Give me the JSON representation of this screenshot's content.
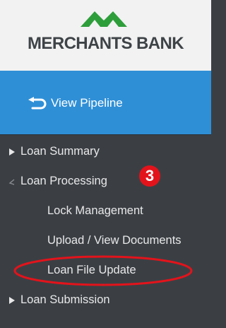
{
  "header": {
    "logo_text": "MERCHANTS BANK",
    "logo_colors": {
      "mark": "#2e9e3b",
      "text": "#3e4347"
    }
  },
  "top_bar": {
    "view_pipeline_label": "View Pipeline",
    "icon": "return-arrow-icon",
    "background": "#2f8fd6"
  },
  "sidebar": {
    "background": "#3b3f44",
    "items": [
      {
        "label": "Loan Summary",
        "state": "collapsed",
        "icon": "caret-right-icon"
      },
      {
        "label": "Loan Processing",
        "state": "expanded",
        "icon": "caret-down-icon",
        "children": [
          {
            "label": "Lock Management"
          },
          {
            "label": "Upload / View Documents"
          },
          {
            "label": "Loan File Update",
            "highlighted": true
          }
        ]
      },
      {
        "label": "Loan Submission",
        "state": "collapsed",
        "icon": "caret-right-icon"
      }
    ]
  },
  "annotation": {
    "step_badge": "3",
    "badge_color": "#e3131b",
    "highlight_color": "#e3131b"
  }
}
